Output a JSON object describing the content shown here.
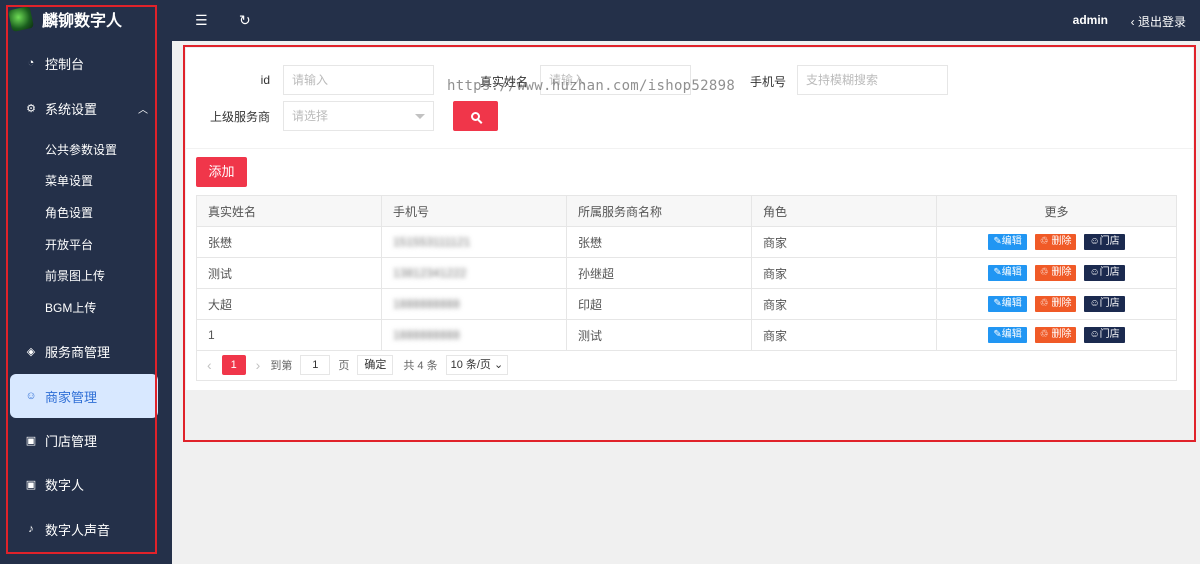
{
  "app": {
    "title": "麟铆数字人"
  },
  "sidebar": {
    "items": [
      {
        "label": "控制台",
        "icon": "dashboard-icon"
      },
      {
        "label": "系统设置",
        "icon": "gear-icon",
        "expanded": true,
        "children": [
          "公共参数设置",
          "菜单设置",
          "角色设置",
          "开放平台",
          "前景图上传",
          "BGM上传"
        ]
      },
      {
        "label": "服务商管理",
        "icon": "diamond-icon"
      },
      {
        "label": "商家管理",
        "icon": "smile-icon",
        "active": true
      },
      {
        "label": "门店管理",
        "icon": "app-add-icon"
      },
      {
        "label": "数字人",
        "icon": "app-add-icon"
      },
      {
        "label": "数字人声音",
        "icon": "music-note-icon"
      }
    ]
  },
  "header": {
    "user": "admin",
    "logout": "退出登录"
  },
  "filters": {
    "id_label": "id",
    "id_placeholder": "请输入",
    "name_label": "真实姓名",
    "name_placeholder": "请输入",
    "phone_label": "手机号",
    "phone_placeholder": "支持模糊搜索",
    "provider_label": "上级服务商",
    "provider_placeholder": "请选择"
  },
  "watermark": "https://www.huzhan.com/ishop52898",
  "toolbar": {
    "add_label": "添加"
  },
  "table": {
    "headers": [
      "真实姓名",
      "手机号",
      "所属服务商名称",
      "角色",
      "更多"
    ],
    "rows": [
      {
        "name": "张懋",
        "phone": "151553111121",
        "provider": "张懋",
        "role": "商家"
      },
      {
        "name": "测试",
        "phone": "13812341222",
        "provider": "孙继超",
        "role": "商家"
      },
      {
        "name": "大超",
        "phone": "1888888888",
        "provider": "印超",
        "role": "商家"
      },
      {
        "name": "1",
        "phone": "1888888888",
        "provider": "测试",
        "role": "商家"
      }
    ],
    "actions": {
      "edit": "编辑",
      "delete": "删除",
      "shop": "门店"
    }
  },
  "pager": {
    "current": "1",
    "goto_label": "到第",
    "page_input": "1",
    "page_unit": "页",
    "confirm": "确定",
    "total": "共 4 条",
    "page_size": "10 条/页"
  },
  "colors": {
    "sidebar_bg": "#243049",
    "accent": "#f0364a",
    "active_bg": "#d8e8ff"
  }
}
